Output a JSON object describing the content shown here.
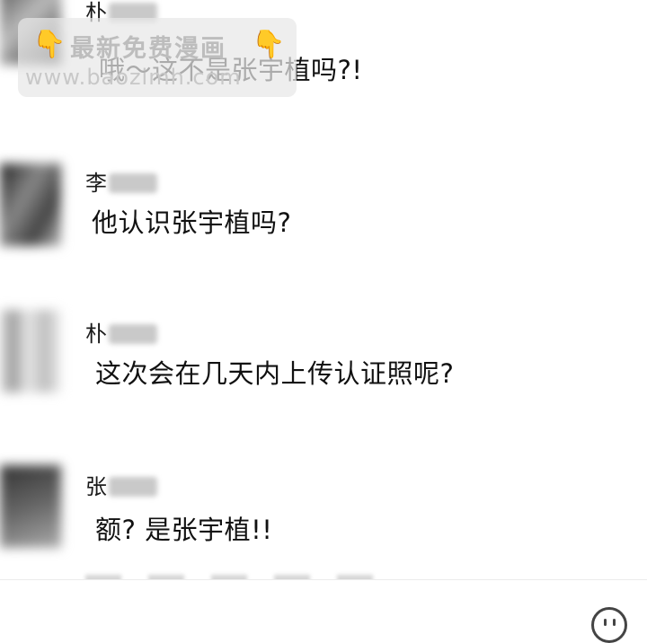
{
  "messages": [
    {
      "id": "m1",
      "sender_initial": "朴",
      "text": "哦～这不是张宇植吗?!"
    },
    {
      "id": "m2",
      "sender_initial": "李",
      "text": "他认识张宇植吗?"
    },
    {
      "id": "m3",
      "sender_initial": "朴",
      "text": "这次会在几天内上传认证照呢?"
    },
    {
      "id": "m4",
      "sender_initial": "张",
      "text": "额? 是张宇植!!"
    }
  ],
  "watermark": {
    "title": "最新免费漫画",
    "url": "www.baozimh.com",
    "icon": "pointing-down-hand-icon",
    "icon_glyph": "👇"
  },
  "input_bar": {
    "emoji_icon": "emoji-face-icon"
  }
}
